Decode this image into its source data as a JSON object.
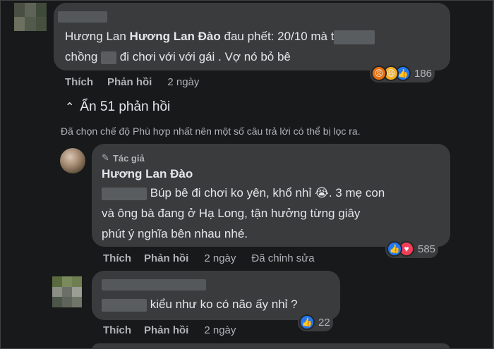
{
  "comment1": {
    "name_part1": "Hương Lan",
    "name_part2": "Hương Lan Đào",
    "text_line1": " đau phết: 20/10 mà t",
    "text_line2_a": "chồng ",
    "text_line2_b": " đi chơi với với gái . Vợ nó bỏ bê",
    "reactions_count": "186",
    "like_label": "Thích",
    "reply_label": "Phản hồi",
    "time": "2 ngày"
  },
  "collapse": {
    "label": "Ẩn 51 phản hồi"
  },
  "filter_note": "Đã chọn chế độ Phù hợp nhất nên một số câu trả lời có thể bị lọc ra.",
  "reply1": {
    "badge": "Tác giả",
    "name": "Hương Lan Đào",
    "text_line1": "Búp bê đi chơi ko yên, khổ nhỉ",
    "text_line1_tail": ". 3 mẹ con",
    "text_line2": "và ông bà đang ở Hạ Long, tận hưởng từng giây",
    "text_line3": "phút ý nghĩa bên nhau nhé.",
    "reactions_count": "585",
    "like_label": "Thích",
    "reply_label": "Phản hồi",
    "time": "2 ngày",
    "edited": "Đã chỉnh sửa"
  },
  "reply2": {
    "text": "kiểu như ko có não ấy nhỉ ?",
    "reactions_count": "22",
    "like_label": "Thích",
    "reply_label": "Phản hồi",
    "time": "2 ngày"
  },
  "colors": {
    "bg": "#18191a",
    "bubble": "#3a3b3c",
    "like_blue": "#2078f4",
    "love_red": "#f33e58",
    "angry_orange": "#e9710f",
    "haha_yellow": "#f7b125"
  }
}
